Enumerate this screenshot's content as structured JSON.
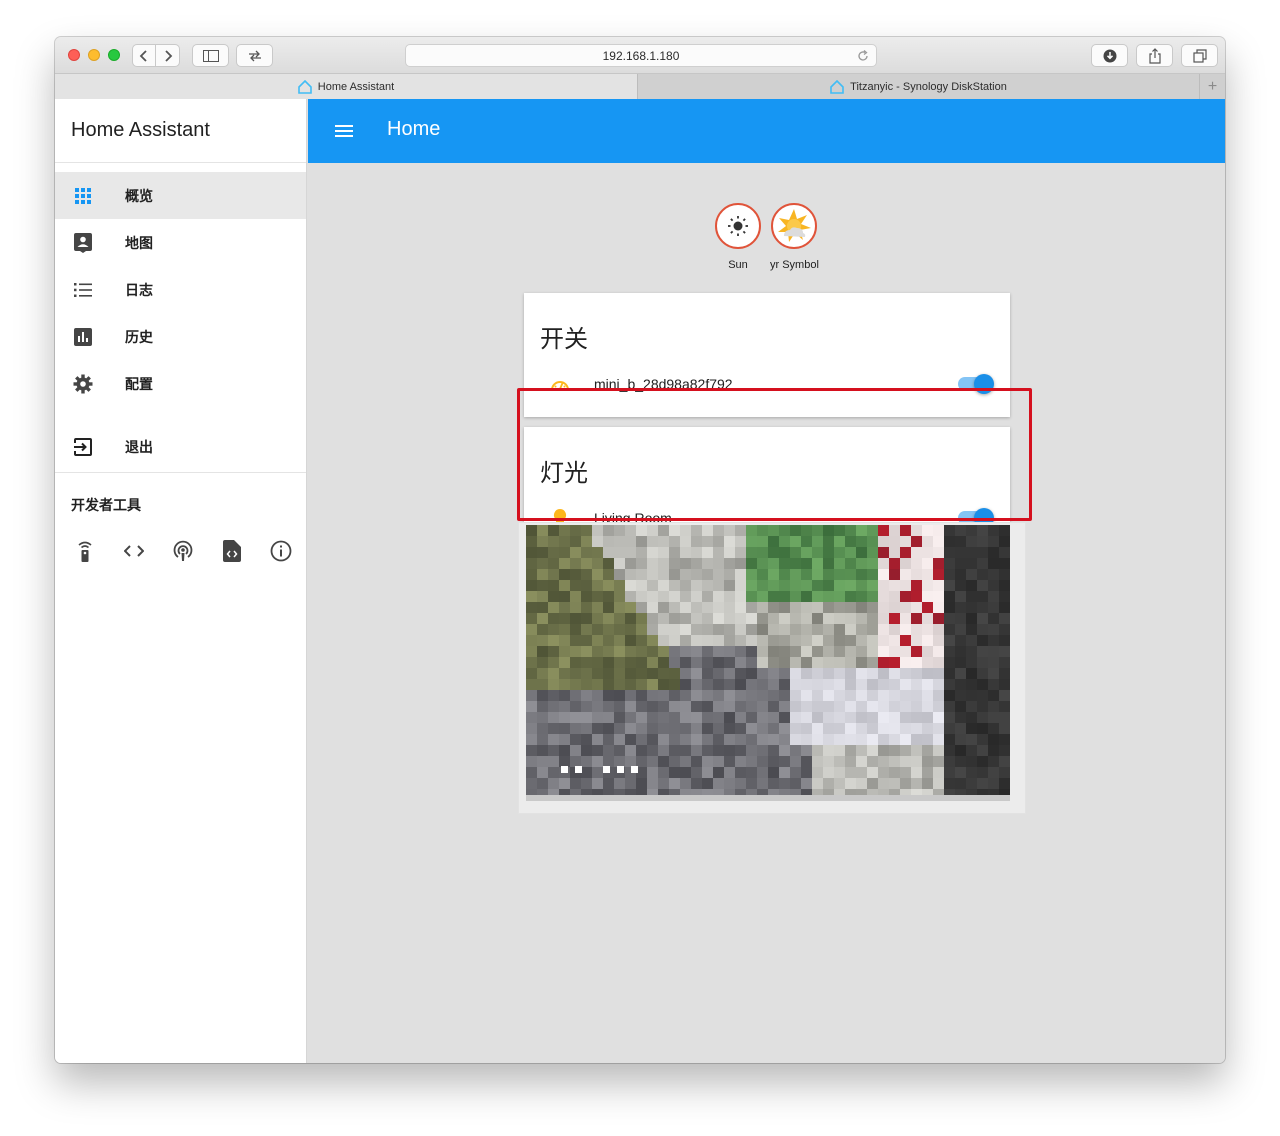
{
  "browser": {
    "url": "192.168.1.180",
    "tabs": [
      {
        "label": "Home Assistant",
        "active": true
      },
      {
        "label": "Titzanyic - Synology DiskStation",
        "active": false
      }
    ],
    "new_tab_glyph": "+"
  },
  "sidebar": {
    "title": "Home Assistant",
    "items": [
      {
        "label": "概览",
        "icon": "grid-icon",
        "active": true
      },
      {
        "label": "地图",
        "icon": "account-box-icon",
        "active": false
      },
      {
        "label": "日志",
        "icon": "format-list-icon",
        "active": false
      },
      {
        "label": "历史",
        "icon": "poll-box-icon",
        "active": false
      },
      {
        "label": "配置",
        "icon": "settings-gear-icon",
        "active": false
      }
    ],
    "logout": {
      "label": "退出",
      "icon": "exit-to-app-icon"
    },
    "dev_tools": {
      "title": "开发者工具",
      "icons": [
        "remote-icon",
        "code-tags-icon",
        "podcast-icon",
        "file-xml-icon",
        "info-outline-icon"
      ]
    }
  },
  "toolbar": {
    "title": "Home",
    "menu_icon": "menu-icon"
  },
  "colors": {
    "accent": "#1696f3",
    "toggle_on": "#1a8fe8",
    "highlight": "#d5101e",
    "icon_yellow": "#fdb71d"
  },
  "badges": [
    {
      "label": "Sun",
      "icon": "sun-icon"
    },
    {
      "label": "yr Symbol",
      "icon": "weather-partly-cloudy-icon"
    }
  ],
  "cards": [
    {
      "title": "开关",
      "entities": [
        {
          "name": "mini_b_28d98a82f792",
          "icon": "gauge-icon",
          "state": "on"
        }
      ]
    },
    {
      "title": "灯光",
      "entities": [
        {
          "name": "Living Room",
          "icon": "lightbulb-icon",
          "state": "on"
        }
      ]
    }
  ],
  "camera": {
    "icon": "camera-feed"
  }
}
